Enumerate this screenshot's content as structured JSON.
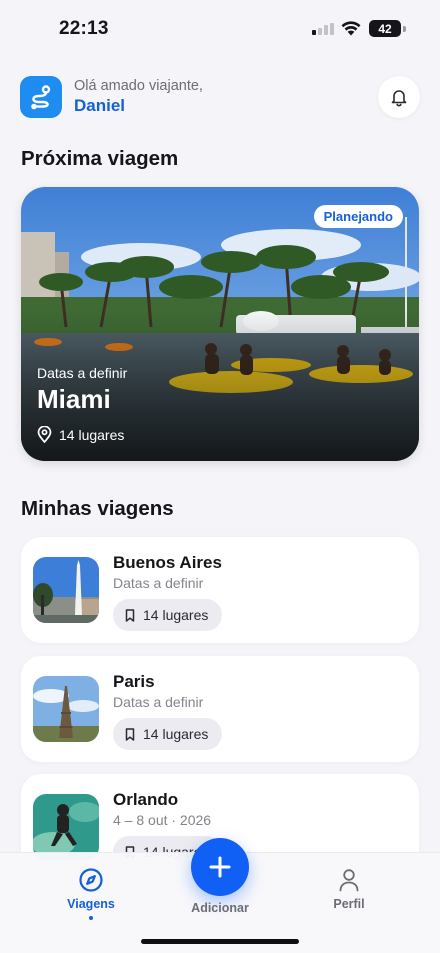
{
  "status_bar": {
    "time": "22:13",
    "battery": "42"
  },
  "header": {
    "greeting": "Olá amado viajante,",
    "user_name": "Daniel"
  },
  "next_trip": {
    "section_title": "Próxima viagem",
    "status": "Planejando",
    "dates": "Datas a definir",
    "city": "Miami",
    "places": "14 lugares"
  },
  "my_trips": {
    "section_title": "Minhas viagens",
    "items": [
      {
        "city": "Buenos Aires",
        "dates": "Datas a definir",
        "places": "14 lugares"
      },
      {
        "city": "Paris",
        "dates": "Datas a definir",
        "places": "14 lugares"
      },
      {
        "city": "Orlando",
        "dates": "4 – 8 out · 2026",
        "places": "14 lugares"
      }
    ]
  },
  "bottom_nav": {
    "trips": "Viagens",
    "add": "Adicionar",
    "profile": "Perfil"
  },
  "icons": {
    "logo": "route-icon",
    "bell": "bell-icon",
    "pin": "map-pin-icon",
    "bookmark": "bookmark-icon",
    "compass": "compass-icon",
    "plus": "plus-icon",
    "person": "person-icon"
  },
  "colors": {
    "accent": "#1460d6",
    "fab": "#1060f5",
    "logo_bg": "#1e8cf0"
  }
}
